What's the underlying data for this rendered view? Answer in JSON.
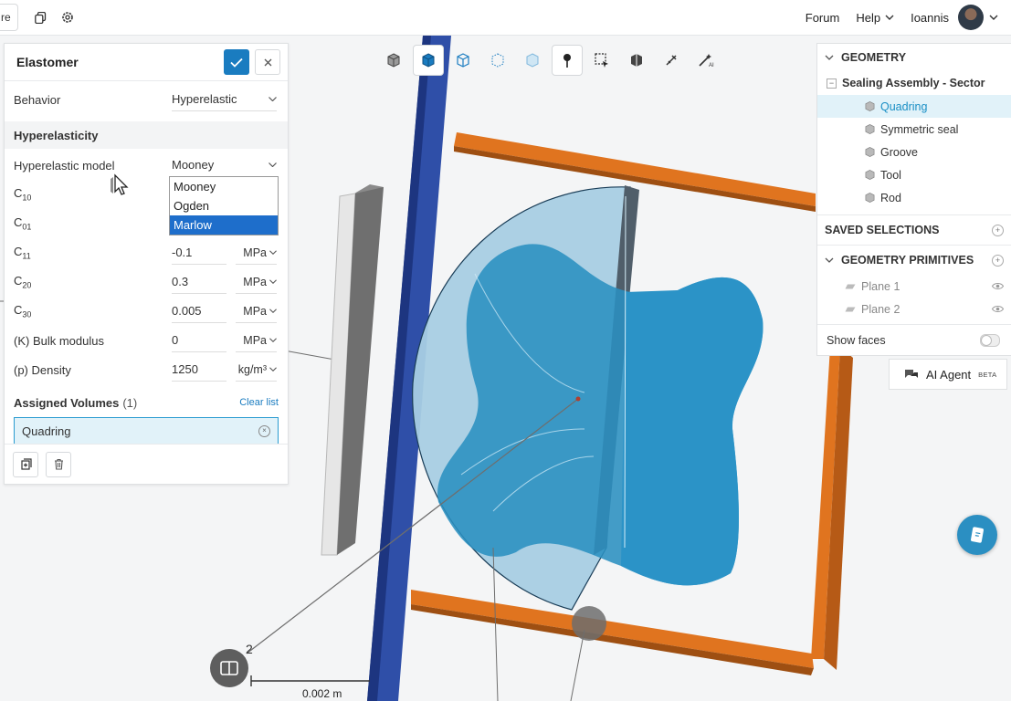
{
  "topbar": {
    "left_box_label": "re",
    "forum": "Forum",
    "help": "Help",
    "user": "Ioannis"
  },
  "toolbar": {
    "tools": [
      "cube-view-icon",
      "solid-view-icon",
      "wireframe-icon",
      "points-icon",
      "transparent-icon",
      "pin-icon",
      "box-select-icon",
      "section-icon",
      "measure-icon",
      "ai-magic-icon"
    ],
    "active_tool": "solid-view-icon"
  },
  "panel": {
    "title": "Elastomer",
    "behavior_label": "Behavior",
    "behavior_value": "Hyperelastic",
    "section_title": "Hyperelasticity",
    "model_label": "Hyperelastic model",
    "model_value": "Mooney",
    "dropdown_options": [
      "Mooney",
      "Ogden",
      "Marlow"
    ],
    "dropdown_highlighted": "Marlow",
    "params": [
      {
        "base": "C",
        "sub": "10",
        "value": "",
        "unit": ""
      },
      {
        "base": "C",
        "sub": "01",
        "value": "",
        "unit": ""
      },
      {
        "base": "C",
        "sub": "11",
        "value": "-0.1",
        "unit": "MPa"
      },
      {
        "base": "C",
        "sub": "20",
        "value": "0.3",
        "unit": "MPa"
      },
      {
        "base": "C",
        "sub": "30",
        "value": "0.005",
        "unit": "MPa"
      }
    ],
    "bulk_label": "(K) Bulk modulus",
    "bulk_value": "0",
    "bulk_unit": "MPa",
    "density_label": "(p) Density",
    "density_value": "1250",
    "density_unit": "kg/m³",
    "assigned_title": "Assigned Volumes",
    "assigned_count": "(1)",
    "clear_list": "Clear list",
    "assigned_items": [
      "Quadring"
    ]
  },
  "tree": {
    "geometry_header": "GEOMETRY",
    "assembly": "Sealing Assembly - Sector",
    "parts": [
      "Quadring",
      "Symmetric seal",
      "Groove",
      "Tool",
      "Rod"
    ],
    "selected_part": "Quadring",
    "saved_selections": "SAVED SELECTIONS",
    "primitives_header": "GEOMETRY PRIMITIVES",
    "primitives": [
      "Plane 1",
      "Plane 2"
    ],
    "show_faces": "Show faces",
    "show_faces_on": false
  },
  "ai_agent": {
    "label": "AI Agent",
    "badge": "BETA"
  },
  "scene": {
    "scale_label": "0.002 m",
    "axis_label": "2"
  },
  "colors": {
    "accent": "#1a7cc0",
    "quadring": "#2a8fc0",
    "rod": "#2f4fa8",
    "tool": "#e0741f",
    "seal": "#d8d8d8"
  }
}
